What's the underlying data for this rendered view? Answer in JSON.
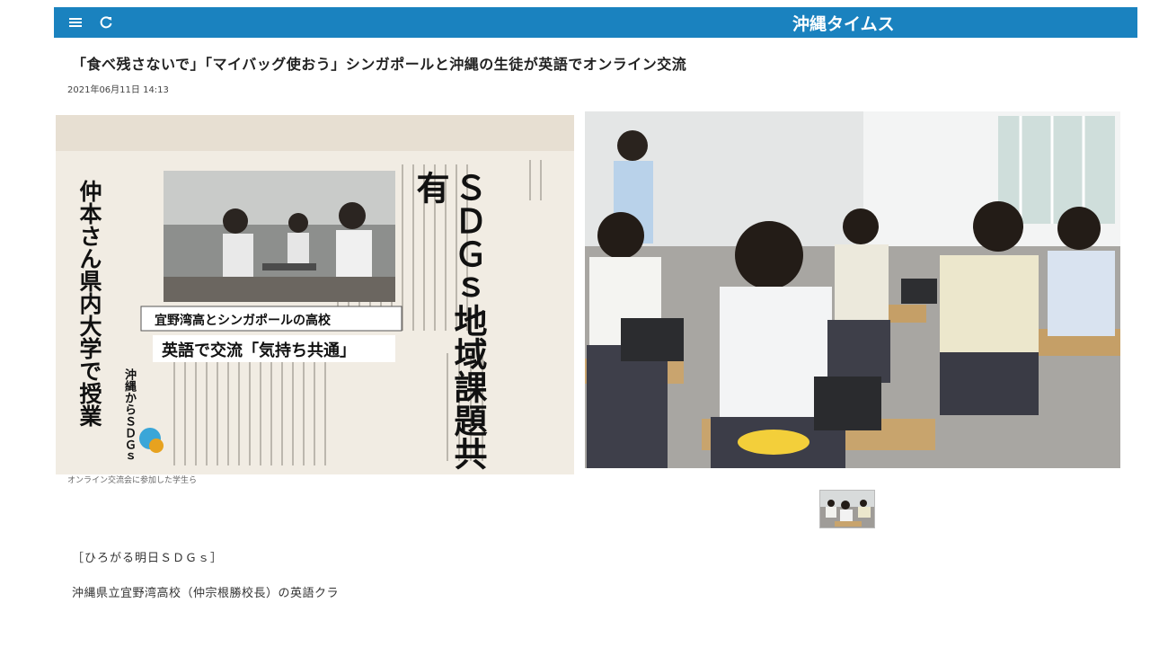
{
  "header": {
    "logo": "沖縄タイムス",
    "brand_color": "#1a82bf",
    "menu_icon": "hamburger-menu-icon",
    "reload_icon": "refresh-icon"
  },
  "article": {
    "title": "「食べ残さないで」「マイバッグ使おう」シンガポールと沖縄の生徒が英語でオンライン交流",
    "date": "2021年06月11日 14:13",
    "image_caption": "オンライン交流会に参加した学生ら",
    "series_label": "［ひろがる明日ＳＤＧｓ］",
    "lead_text": "沖縄県立宜野湾高校（仲宗根勝校長）の英語クラ"
  },
  "newspaper_clip": {
    "headline_main": "ＳＤＧｓ地域課題共有",
    "headline_sub": "英語で交流「気持ち共通」",
    "headline_school": "宜野湾高とシンガポールの高校",
    "side_headline": "仲本さん県内大学で授業",
    "logo_text": "沖縄からＳＤＧｓ"
  }
}
